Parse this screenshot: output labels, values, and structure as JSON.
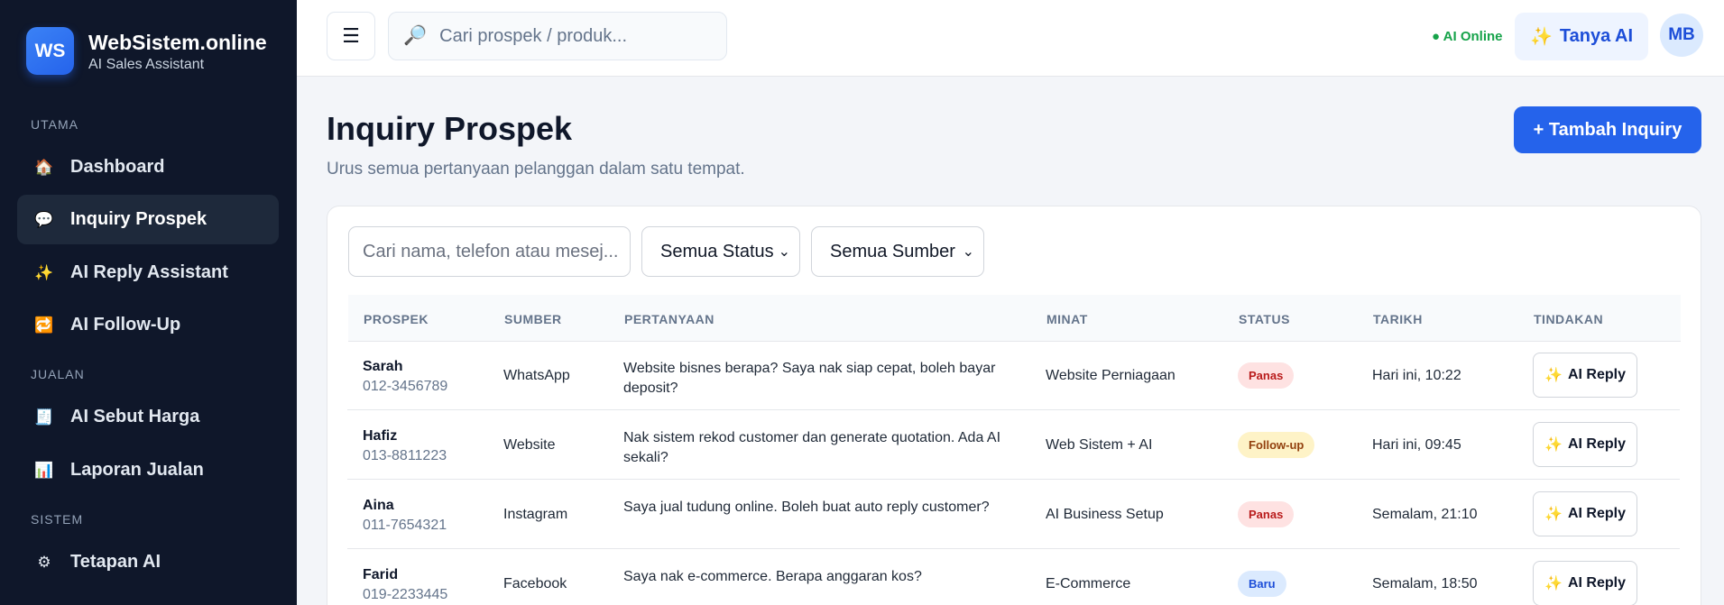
{
  "brand": {
    "logo": "WS",
    "name": "WebSistem.online",
    "subtitle": "AI Sales Assistant"
  },
  "sidebar": {
    "sections": [
      {
        "label": "UTAMA"
      },
      {
        "label": "JUALAN"
      },
      {
        "label": "SISTEM"
      }
    ],
    "items": [
      {
        "label": "Dashboard",
        "icon": "house-icon",
        "glyph": "🏠",
        "active": false
      },
      {
        "label": "Inquiry Prospek",
        "icon": "chat-icon",
        "glyph": "💬",
        "active": true
      },
      {
        "label": "AI Reply Assistant",
        "icon": "sparkles-icon",
        "glyph": "✨",
        "active": false
      },
      {
        "label": "AI Follow-Up",
        "icon": "repeat-icon",
        "glyph": "🔁",
        "active": false
      },
      {
        "label": "AI Sebut Harga",
        "icon": "receipt-icon",
        "glyph": "🧾",
        "active": false
      },
      {
        "label": "Laporan Jualan",
        "icon": "bar-chart-icon",
        "glyph": "📊",
        "active": false
      },
      {
        "label": "Tetapan AI",
        "icon": "gear-icon",
        "glyph": "⚙",
        "active": false
      }
    ]
  },
  "topbar": {
    "menu_glyph": "☰",
    "search_placeholder": "Cari prospek / produk...",
    "ai_status": "● AI Online",
    "ask_ai_label": "Tanya AI",
    "avatar_initials": "MB"
  },
  "page": {
    "title": "Inquiry Prospek",
    "subtitle": "Urus semua pertanyaan pelanggan dalam satu tempat.",
    "add_button": "+ Tambah Inquiry"
  },
  "filters": {
    "search_placeholder": "Cari nama, telefon atau mesej...",
    "status_selected": "Semua Status",
    "source_selected": "Semua Sumber"
  },
  "table": {
    "headers": [
      "PROSPEK",
      "SUMBER",
      "PERTANYAAN",
      "MINAT",
      "STATUS",
      "TARIKH",
      "TINDAKAN"
    ],
    "action_label": "AI Reply",
    "rows": [
      {
        "name": "Sarah",
        "phone": "012-3456789",
        "source": "WhatsApp",
        "question": "Website bisnes berapa? Saya nak siap cepat, boleh bayar deposit?",
        "interest": "Website Perniagaan",
        "status": "Panas",
        "date": "Hari ini, 10:22"
      },
      {
        "name": "Hafiz",
        "phone": "013-8811223",
        "source": "Website",
        "question": "Nak sistem rekod customer dan generate quotation. Ada AI sekali?",
        "interest": "Web Sistem + AI",
        "status": "Follow-up",
        "date": "Hari ini, 09:45"
      },
      {
        "name": "Aina",
        "phone": "011-7654321",
        "source": "Instagram",
        "question": "Saya jual tudung online. Boleh buat auto reply customer?",
        "interest": "AI Business Setup",
        "status": "Panas",
        "date": "Semalam, 21:10"
      },
      {
        "name": "Farid",
        "phone": "019-2233445",
        "source": "Facebook",
        "question": "Saya nak e-commerce. Berapa anggaran kos?",
        "interest": "E-Commerce",
        "status": "Baru",
        "date": "Semalam, 18:50"
      }
    ]
  },
  "status_colors": {
    "Panas": {
      "bg": "#fee2e2",
      "fg": "#b91c1c"
    },
    "Follow-up": {
      "bg": "#fef3c7",
      "fg": "#92400e"
    },
    "Baru": {
      "bg": "#dbeafe",
      "fg": "#1d4ed8"
    }
  },
  "colors": {
    "primary": "#2563eb",
    "sidebar_bg": "#0f172a",
    "online": "#16a34a"
  }
}
